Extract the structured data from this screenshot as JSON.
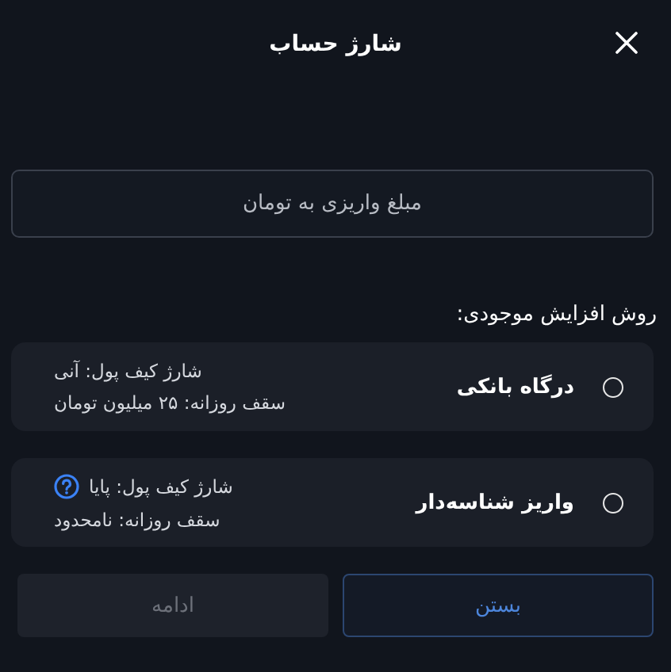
{
  "dialog": {
    "title": "شارژ حساب"
  },
  "amount_field": {
    "placeholder": "مبلغ واریزی به تومان"
  },
  "methods_label": "روش افزایش موجودی:",
  "methods": [
    {
      "title": "درگاه بانکی",
      "selected": false,
      "help": false,
      "details": [
        "شارژ کیف پول: آنی",
        "سقف روزانه: ۲۵ میلیون تومان"
      ]
    },
    {
      "title": "واریز شناسه‌دار",
      "selected": false,
      "help": true,
      "details": [
        "شارژ کیف پول: پایا",
        "سقف روزانه: نامحدود"
      ]
    }
  ],
  "buttons": [
    {
      "label": "بستن",
      "kind": "secondary",
      "disabled": false
    },
    {
      "label": "ادامه",
      "kind": "primary",
      "disabled": true
    }
  ]
}
